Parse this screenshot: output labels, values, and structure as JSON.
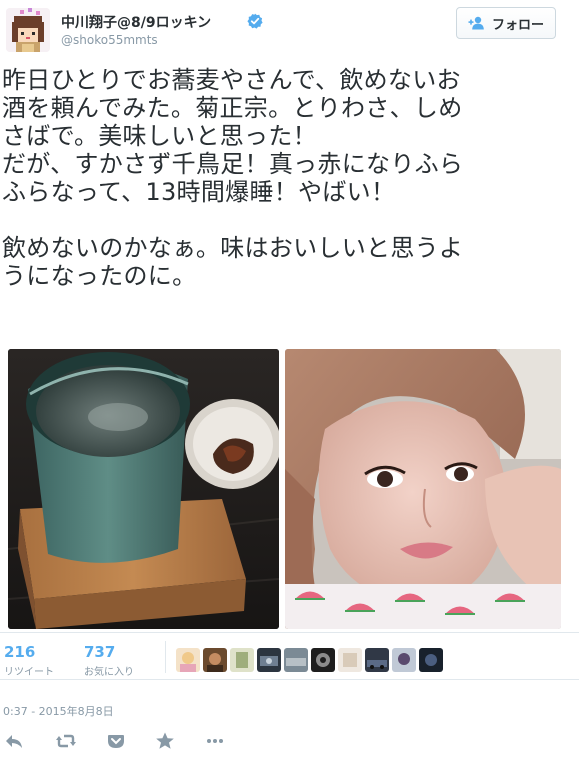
{
  "user": {
    "display_name": "中川翔子@8/9ロッキン",
    "handle": "@shoko55mmts",
    "verified_icon": "verified-badge-icon",
    "avatar_icon": "pixel-art-avatar"
  },
  "follow_button": {
    "label": "フォロー",
    "icon": "add-user-icon"
  },
  "tweet": {
    "lines": [
      "昨日ひとりでお蕎麦やさんで、飲めないお",
      "酒を頼んでみた。菊正宗。とりわさ、しめ",
      "さばで。美味しいと思った！",
      "だが、すかさず千鳥足！真っ赤になりふら",
      "ふらなって、13時間爆睡！やばい！",
      "",
      "飲めないのかなぁ。味はおいしいと思うよ",
      "うになったのに。"
    ]
  },
  "photos": [
    {
      "name": "sake-cup-photo"
    },
    {
      "name": "selfie-photo"
    }
  ],
  "stats": {
    "retweets": {
      "count": "216",
      "label": "リツイート"
    },
    "favorites": {
      "count": "737",
      "label": "お気に入り"
    }
  },
  "timestamp": "0:37 - 2015年8月8日",
  "actions": [
    "reply-icon",
    "retweet-icon",
    "pocket-icon",
    "favorite-star-icon",
    "more-icon"
  ],
  "colors": {
    "accent": "#55acee",
    "muted": "#8899a6",
    "text": "#292f33",
    "border": "#e1e8ed"
  }
}
